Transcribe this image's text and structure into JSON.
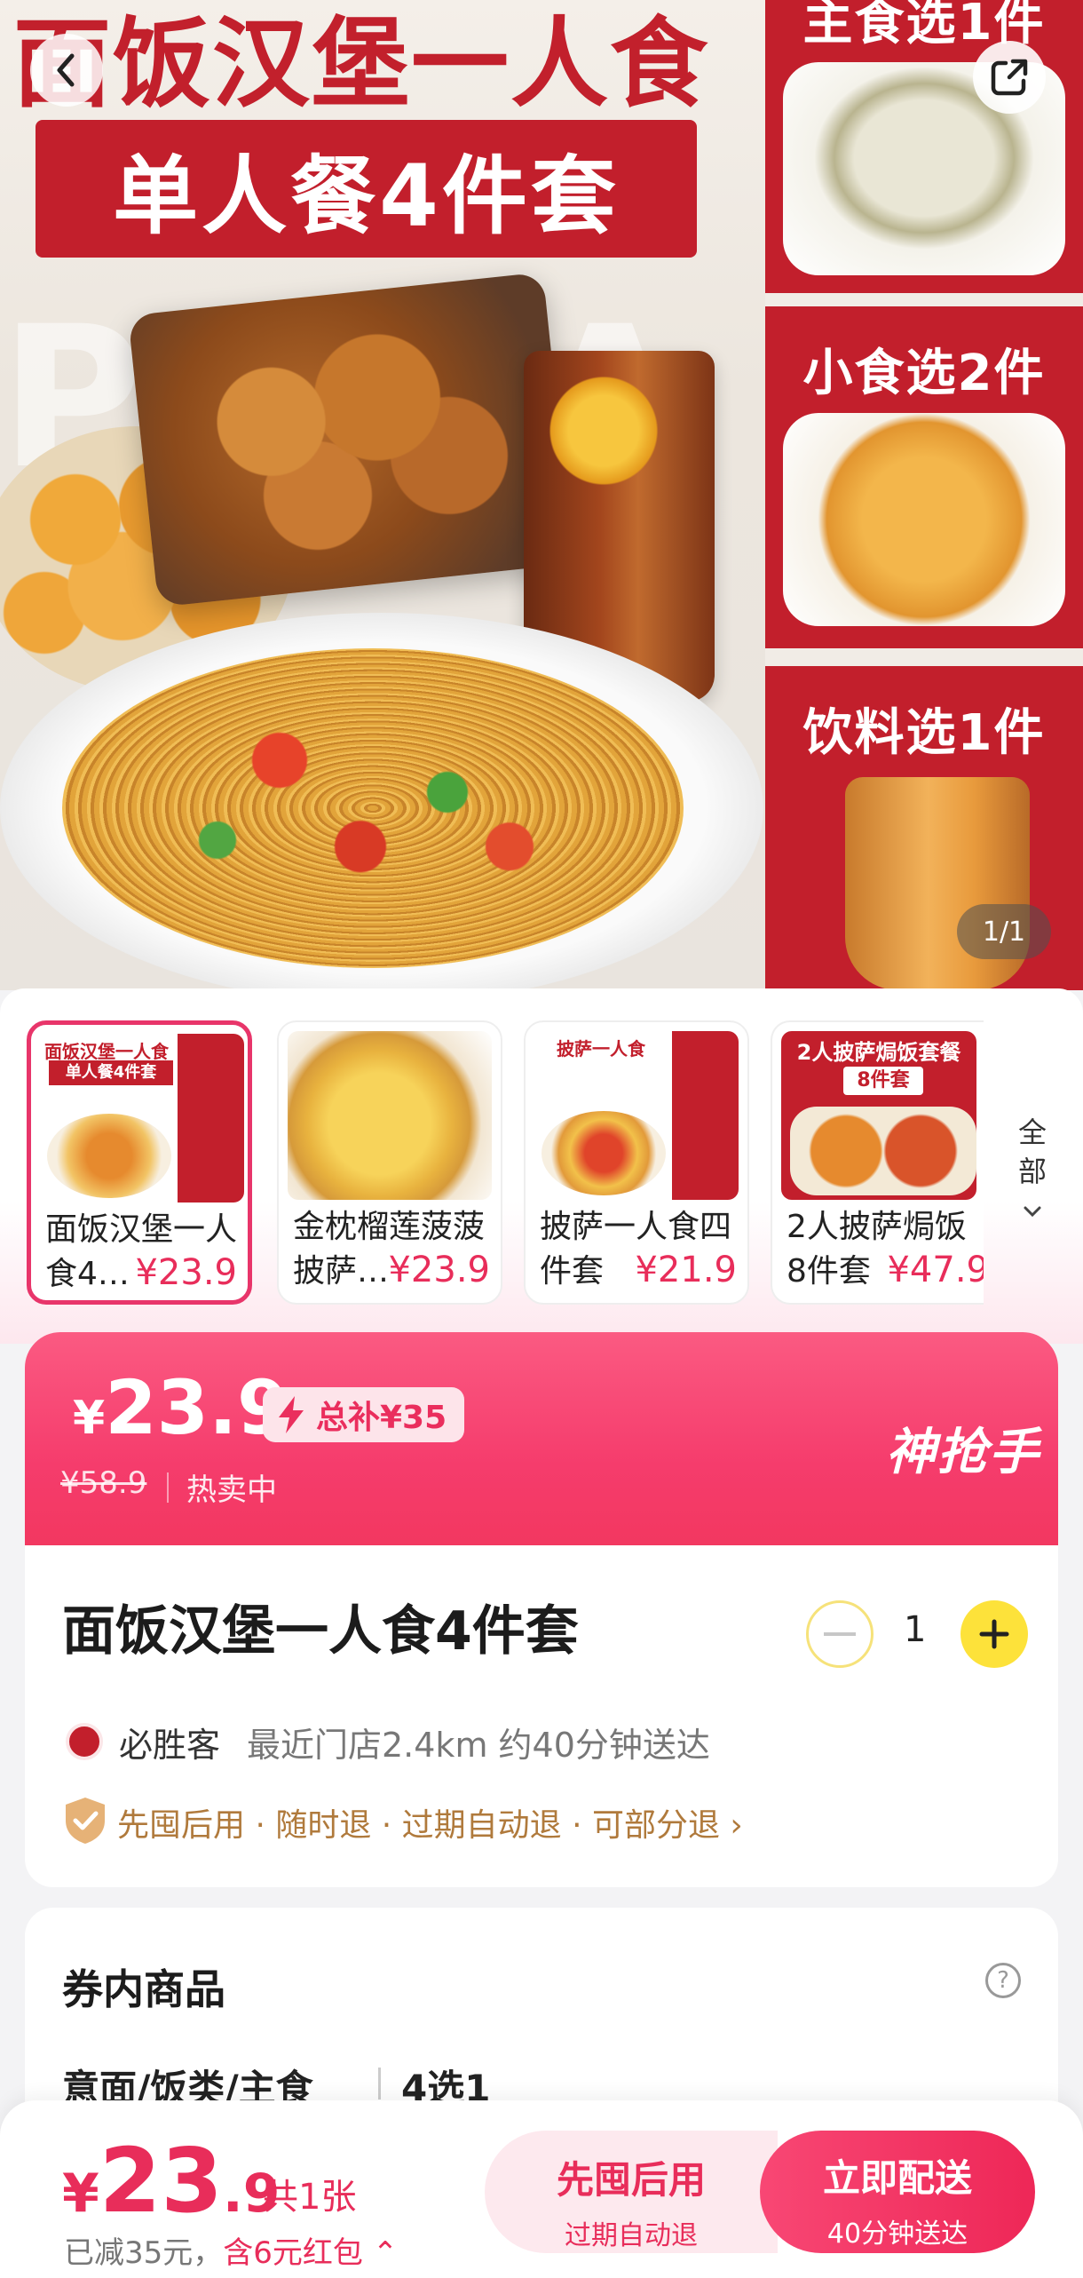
{
  "hero": {
    "title": "面饭汉堡一人食",
    "subtitle": "单人餐4件套",
    "side_cards": [
      {
        "label": "主食选1件"
      },
      {
        "label": "小食选2件"
      },
      {
        "label": "饮料选1件"
      }
    ],
    "pager": "1/1"
  },
  "products": [
    {
      "name": "面饭汉堡一人食4…",
      "price": "¥23.9",
      "selected": true
    },
    {
      "name": "金枕榴莲菠菠披萨…",
      "price": "¥23.9",
      "selected": false
    },
    {
      "name": "披萨一人食四件套",
      "price": "¥21.9",
      "selected": false
    },
    {
      "name": "2人披萨焗饭8件套",
      "price": "¥47.9",
      "selected": false
    }
  ],
  "thumbs": {
    "t1_title": "面饭汉堡一人食",
    "t1_band": "单人餐4件套",
    "t3_title": "披萨一人食",
    "t4_title": "2人披萨焗饭套餐",
    "t4_sub": "8件套"
  },
  "all_toggle": "全部",
  "promo": {
    "yen": "¥",
    "price": "23.9",
    "subsidy": "总补¥35",
    "original": "¥58.9",
    "status": "热卖中",
    "brand": "神抢手"
  },
  "info": {
    "title": "面饭汉堡一人食4件套",
    "quantity": "1",
    "store": "必胜客",
    "store_meta": "最近门店2.4km  约40分钟送达",
    "policy": "先囤后用 · 随时退 · 过期自动退 · 可部分退 ›"
  },
  "voucher": {
    "title": "券内商品",
    "category": "意面/饭类/主食",
    "count": "4选1"
  },
  "bottom": {
    "yen": "¥",
    "price_int": "23",
    "price_dec": ".9",
    "count": "共1张",
    "saved": "已减35元，",
    "red_packet": "含6元红包 ⌃",
    "later_label": "先囤后用",
    "later_sub": "过期自动退",
    "deliver_label": "立即配送",
    "deliver_sub": "40分钟送达"
  },
  "colors": {
    "brand_red": "#c21f2c",
    "accent_pink": "#e82d5a",
    "promo_pink": "#f53c6c",
    "stepper_yellow": "#fde23a"
  }
}
